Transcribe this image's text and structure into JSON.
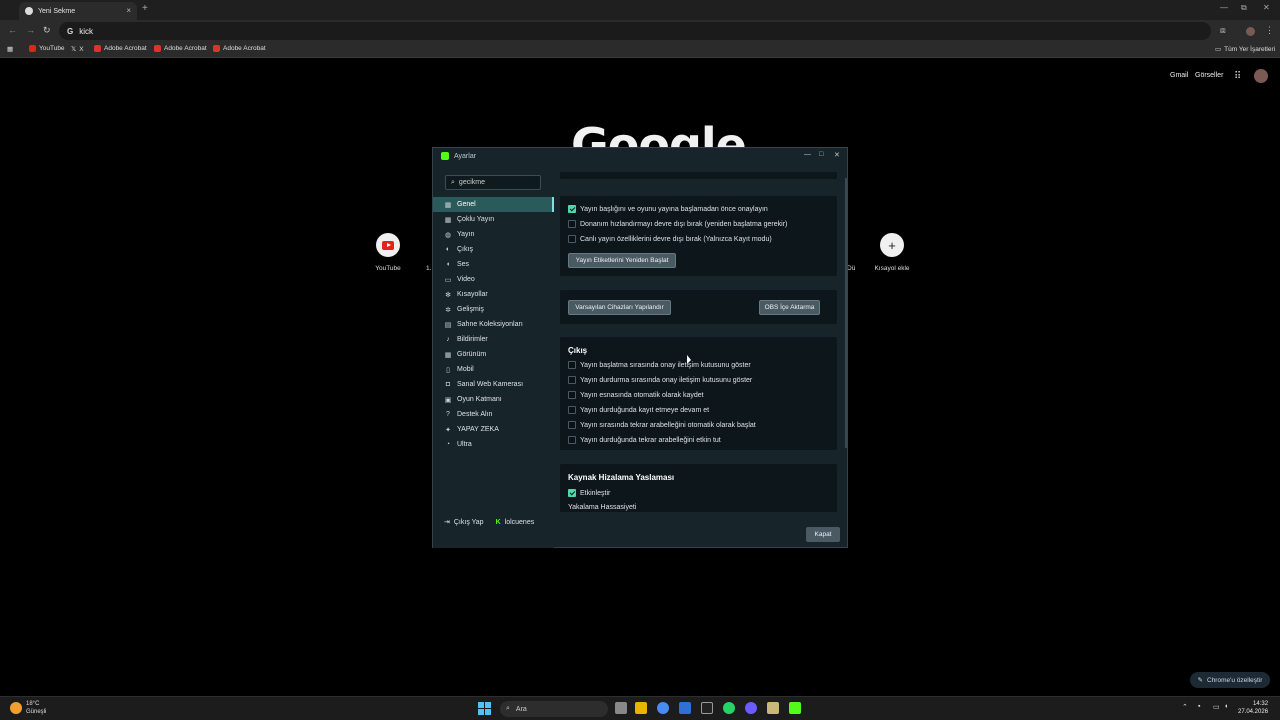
{
  "browser": {
    "tab_title": "Yeni Sekme",
    "tab_close": "×",
    "new_tab": "+",
    "window_controls": [
      "—",
      "⧉",
      "✕"
    ],
    "address": "kick",
    "bookmarks": [
      {
        "label": "YouTube",
        "color": "#e62117"
      },
      {
        "label": "X",
        "color": "#cccccc"
      },
      {
        "label": "Adobe Acrobat",
        "color": "#e0322a"
      },
      {
        "label": "Adobe Acrobat",
        "color": "#e0322a"
      },
      {
        "label": "Adobe Acrobat",
        "color": "#e0322a"
      }
    ],
    "all_bookmarks": "Tüm Yer İşaretleri"
  },
  "ntp": {
    "gmail": "Gmail",
    "images": "Görseller",
    "logo": "Google",
    "shortcuts": [
      {
        "label": "YouTube"
      },
      {
        "label": "Kısayol ekle"
      }
    ],
    "partial_left": "1.",
    "partial_right": "Dü",
    "customize": "Chrome'u özelleştir"
  },
  "dialog": {
    "title": "Ayarlar",
    "controls": [
      "—",
      "□",
      "✕"
    ],
    "search_value": "gecikme",
    "nav": [
      {
        "label": "Genel",
        "icon": "grid-icon",
        "glyph": "▦",
        "active": true
      },
      {
        "label": "Çoklu Yayın",
        "icon": "multistream-icon",
        "glyph": "▦",
        "active": false
      },
      {
        "label": "Yayın",
        "icon": "globe-icon",
        "glyph": "◍",
        "active": false
      },
      {
        "label": "Çıkış",
        "icon": "output-icon",
        "glyph": "◐",
        "active": false
      },
      {
        "label": "Ses",
        "icon": "speaker-icon",
        "glyph": "◖",
        "active": false
      },
      {
        "label": "Video",
        "icon": "video-icon",
        "glyph": "▭",
        "active": false
      },
      {
        "label": "Kısayollar",
        "icon": "gear-icon",
        "glyph": "✻",
        "active": false
      },
      {
        "label": "Gelişmiş",
        "icon": "gears-icon",
        "glyph": "✲",
        "active": false
      },
      {
        "label": "Sahne Koleksiyonları",
        "icon": "collection-icon",
        "glyph": "▤",
        "active": false
      },
      {
        "label": "Bildirimler",
        "icon": "bell-icon",
        "glyph": "♪",
        "active": false
      },
      {
        "label": "Görünüm",
        "icon": "appearance-icon",
        "glyph": "▦",
        "active": false
      },
      {
        "label": "Mobil",
        "icon": "mobile-icon",
        "glyph": "▯",
        "active": false
      },
      {
        "label": "Sanal Web Kamerası",
        "icon": "camera-icon",
        "glyph": "◘",
        "active": false
      },
      {
        "label": "Oyun Katmanı",
        "icon": "overlay-icon",
        "glyph": "▣",
        "active": false
      },
      {
        "label": "Destek Alın",
        "icon": "help-icon",
        "glyph": "?",
        "active": false
      },
      {
        "label": "YAPAY ZEKA",
        "icon": "ai-icon",
        "glyph": "✦",
        "active": false
      },
      {
        "label": "Ultra",
        "icon": "ultra-icon",
        "glyph": "◔",
        "active": false
      }
    ],
    "logout": "Çıkış Yap",
    "username": "lolcuenes",
    "panel1": {
      "checks": [
        {
          "label": "Yayın başlığını ve oyunu yayına başlamadan önce onaylayın",
          "checked": true
        },
        {
          "label": "Donanım hızlandırmayı devre dışı bırak (yeniden başlatma gerekir)",
          "checked": false
        },
        {
          "label": "Canlı yayın özelliklerini devre dışı bırak (Yalnızca Kayıt modu)",
          "checked": false
        }
      ],
      "restart_button": "Yayın Etiketlerini Yeniden Başlat"
    },
    "panel2": {
      "default_devices": "Varsayılan Cihazları Yapılandır",
      "obs_import": "OBS İçe Aktarma"
    },
    "panel3": {
      "title": "Çıkış",
      "checks": [
        {
          "label": "Yayın başlatma sırasında onay iletişim kutusunu göster",
          "checked": false
        },
        {
          "label": "Yayın durdurma sırasında onay iletişim kutusunu göster",
          "checked": false
        },
        {
          "label": "Yayın esnasında otomatik olarak kaydet",
          "checked": false
        },
        {
          "label": "Yayın durduğunda kayıt etmeye devam et",
          "checked": false
        },
        {
          "label": "Yayın sırasında tekrar arabelleğini otomatik olarak başlat",
          "checked": false
        },
        {
          "label": "Yayın durduğunda tekrar arabelleğini etkin tut",
          "checked": false
        }
      ]
    },
    "panel4": {
      "title": "Kaynak Hizalama Yaslaması",
      "enable": "Etkinleştir",
      "enable_checked": true,
      "sensitivity": "Yakalama Hassasiyeti"
    },
    "close_button": "Kapat"
  },
  "taskbar": {
    "temp": "18°C",
    "condition": "Güneşli",
    "search": "Ara",
    "time": "14:32",
    "date": "27.04.2026",
    "accent": "#4cc2ff"
  }
}
